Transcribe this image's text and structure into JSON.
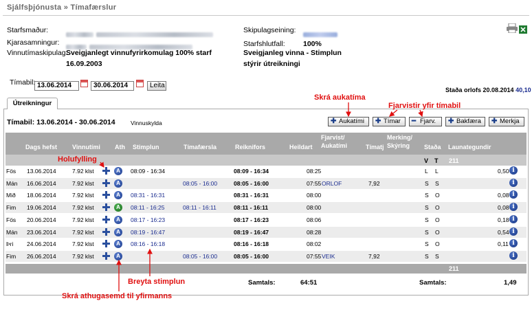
{
  "breadcrumb": "Sjálfsþjónusta » Tímafærslur",
  "info": {
    "employee_label": "Starfsmaður:",
    "contract_label": "Kjarasamningur:",
    "pattern_label": "Vinnutímaskipulag:",
    "pattern_value1": "Sveigjanlegt vinnufyrirkomulag 100% starf",
    "pattern_value2": "16.09.2003",
    "unit_label": "Skipulagseining:",
    "ratio_label": "Starfshlutfall:",
    "ratio_value": "100%",
    "flex_value1": "Sveigjanleg vinna - Stimplun",
    "flex_value2": "stýrir útreikningi"
  },
  "period": {
    "label": "Tímabil:",
    "from": "13.06.2014",
    "to": "30.06.2014",
    "search_button": "Leita"
  },
  "leave_status": {
    "text": "Staða orlofs 20.08.2014",
    "value": "40,10"
  },
  "tab_label": "Útreikningur",
  "summary": {
    "title": "Tímabil: 13.06.2014 - 30.06.2014",
    "obligation": "Vinnuskylda"
  },
  "toolbar": {
    "overtime": "Aukatími",
    "hours": "Tímar",
    "absence": "Fjarv.",
    "post": "Bakfæra",
    "mark": "Merkja"
  },
  "columns": {
    "date": "Dags hefst",
    "work": "Vinnutími",
    "ath": "Ath",
    "punch": "Stimplun",
    "entry": "Tímafærsla",
    "calc": "Reiknifors",
    "total": "Heildart",
    "absence1": "Fjarvist/",
    "absence2": "Aukatími",
    "timatj": "Tímatj",
    "mark1": "Merking/",
    "mark2": "Skýring",
    "status": "Staða",
    "status_v": "V",
    "status_t": "T",
    "wage": "Launategundir",
    "wage_code": "211"
  },
  "rows": [
    {
      "day": "Fös",
      "date": "13.06.2014",
      "work": "7.92 klst",
      "ath_green": false,
      "punch": "08:09 - 16:34",
      "punch_link": false,
      "entry": "",
      "calc": "08:09 - 16:34",
      "total": "08:25",
      "absence": "",
      "timatj": "",
      "mark": "",
      "v": "L",
      "t": "L",
      "wage": "0,50"
    },
    {
      "day": "Mán",
      "date": "16.06.2014",
      "work": "7.92 klst",
      "ath_green": false,
      "punch": "",
      "punch_link": false,
      "entry": "08:05 - 16:00",
      "calc": "08:05 - 16:00",
      "total": "07:55",
      "absence": "ORLOF",
      "timatj": "7,92",
      "mark": "",
      "v": "S",
      "t": "S",
      "wage": ""
    },
    {
      "day": "Mið",
      "date": "18.06.2014",
      "work": "7.92 klst",
      "ath_green": false,
      "punch": "08:31 - 16:31",
      "punch_link": true,
      "entry": "",
      "calc": "08:31 - 16:31",
      "total": "08:00",
      "absence": "",
      "timatj": "",
      "mark": "",
      "v": "S",
      "t": "O",
      "wage": "0,08"
    },
    {
      "day": "Fim",
      "date": "19.06.2014",
      "work": "7.92 klst",
      "ath_green": true,
      "punch": "08:11 - 16:25",
      "punch_link": true,
      "entry": "08:11 - 16:11",
      "calc": "08:11 - 16:11",
      "total": "08:00",
      "absence": "",
      "timatj": "",
      "mark": "",
      "v": "S",
      "t": "O",
      "wage": "0,08"
    },
    {
      "day": "Fös",
      "date": "20.06.2014",
      "work": "7.92 klst",
      "ath_green": false,
      "punch": "08:17 - 16:23",
      "punch_link": true,
      "entry": "",
      "calc": "08:17 - 16:23",
      "total": "08:06",
      "absence": "",
      "timatj": "",
      "mark": "",
      "v": "S",
      "t": "O",
      "wage": "0,18"
    },
    {
      "day": "Mán",
      "date": "23.06.2014",
      "work": "7.92 klst",
      "ath_green": false,
      "punch": "08:19 - 16:47",
      "punch_link": true,
      "entry": "",
      "calc": "08:19 - 16:47",
      "total": "08:28",
      "absence": "",
      "timatj": "",
      "mark": "",
      "v": "S",
      "t": "O",
      "wage": "0,54"
    },
    {
      "day": "Þri",
      "date": "24.06.2014",
      "work": "7.92 klst",
      "ath_green": false,
      "punch": "08:16 - 16:18",
      "punch_link": true,
      "entry": "",
      "calc": "08:16 - 16:18",
      "total": "08:02",
      "absence": "",
      "timatj": "",
      "mark": "",
      "v": "S",
      "t": "O",
      "wage": "0,11"
    },
    {
      "day": "Fim",
      "date": "26.06.2014",
      "work": "7.92 klst",
      "ath_green": false,
      "punch": "",
      "punch_link": false,
      "entry": "08:05 - 16:00",
      "calc": "08:05 - 16:00",
      "total": "07:55",
      "absence": "VEIK",
      "timatj": "7,92",
      "mark": "",
      "v": "S",
      "t": "S",
      "wage": ""
    }
  ],
  "footer_wage_code": "211",
  "totals": {
    "label1": "Samtals:",
    "value1": "64:51",
    "label2": "Samtals:",
    "value2": "1,49"
  },
  "annotations": {
    "overtime": "Skrá aukatíma",
    "absence": "Fjarvistir yfir tímabil",
    "fill": "Holufylling",
    "change_punch": "Breyta stimplun",
    "comment": "Skrá athugasemd til yfirmanns"
  },
  "colors": {
    "annotation": "#e01010",
    "link": "#1a2c8f",
    "header": "#a9a9a9"
  }
}
